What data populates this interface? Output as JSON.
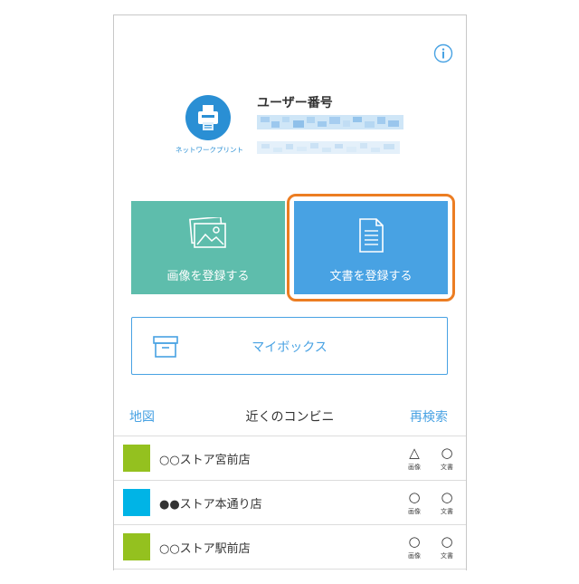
{
  "colors": {
    "accent": "#48a2e3",
    "image_button": "#5ebdac",
    "document_button": "#48a2e3",
    "highlight": "#ec7d22",
    "store_green": "#94c11f",
    "store_blue": "#00b4e6"
  },
  "header": {
    "info_icon": "info-icon",
    "logo_icon": "printer-icon",
    "logo_text": "ネットワークプリント",
    "user_number_label": "ユーザー番号"
  },
  "actions": {
    "register_image_label": "画像を登録する",
    "register_image_icon": "images-icon",
    "register_document_label": "文書を登録する",
    "register_document_icon": "document-icon",
    "mybox_label": "マイボックス",
    "mybox_icon": "box-icon"
  },
  "nearby": {
    "map_link": "地図",
    "title": "近くのコンビニ",
    "research_link": "再検索",
    "stores": [
      {
        "name": "○○ストア宮前店",
        "color": "#94c11f",
        "image_mark": "△",
        "image_label": "画像",
        "doc_mark": "○",
        "doc_label": "文書"
      },
      {
        "name": "●●ストア本通り店",
        "color": "#00b4e6",
        "image_mark": "○",
        "image_label": "画像",
        "doc_mark": "○",
        "doc_label": "文書"
      },
      {
        "name": "○○ストア駅前店",
        "color": "#94c11f",
        "image_mark": "○",
        "image_label": "画像",
        "doc_mark": "○",
        "doc_label": "文書"
      }
    ]
  }
}
